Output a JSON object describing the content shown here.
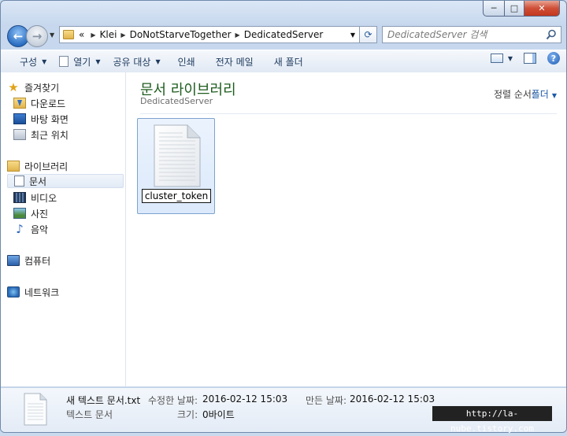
{
  "window": {
    "caption": {
      "minimize": "─",
      "maximize": "□",
      "close": "✕"
    }
  },
  "nav": {
    "breadcrumb": [
      "«",
      "Klei",
      "DoNotStarveTogether",
      "DedicatedServer"
    ],
    "search_placeholder": "DedicatedServer 검색",
    "icons": {
      "back": "back-arrow-icon",
      "forward": "forward-arrow-icon",
      "refresh": "refresh-icon",
      "search": "search-icon"
    }
  },
  "toolbar": {
    "organize": "구성",
    "open": "열기",
    "share": "공유 대상",
    "print": "인쇄",
    "email": "전자 메일",
    "new_folder": "새 폴더",
    "help": "?"
  },
  "sidebar": {
    "favorites": {
      "label": "즐겨찾기",
      "items": [
        "다운로드",
        "바탕 화면",
        "최근 위치"
      ]
    },
    "libraries": {
      "label": "라이브러리",
      "items": [
        "문서",
        "비디오",
        "사진",
        "음악"
      ]
    },
    "computer": "컴퓨터",
    "network": "네트워크",
    "selected": "문서"
  },
  "content": {
    "title": "문서 라이브러리",
    "subtitle": "DedicatedServer",
    "sort_label": "정렬 순서:",
    "sort_value": "폴더",
    "files": [
      {
        "name": "cluster_token",
        "renaming": true,
        "icon": "text-file-icon"
      }
    ]
  },
  "details": {
    "name": "새 텍스트 문서.txt",
    "type": "텍스트 문서",
    "modified_label": "수정한 날짜:",
    "modified_value": "2016-02-12 15:03",
    "created_label": "만든 날짜:",
    "created_value": "2016-02-12 15:03",
    "size_label": "크기:",
    "size_value": "0바이트"
  },
  "watermark": "http://la-nube.tistory.com",
  "colors": {
    "library_title": "#1e5c1e",
    "selection_border": "#7da2ce",
    "accent_link": "#1e5aa8"
  }
}
